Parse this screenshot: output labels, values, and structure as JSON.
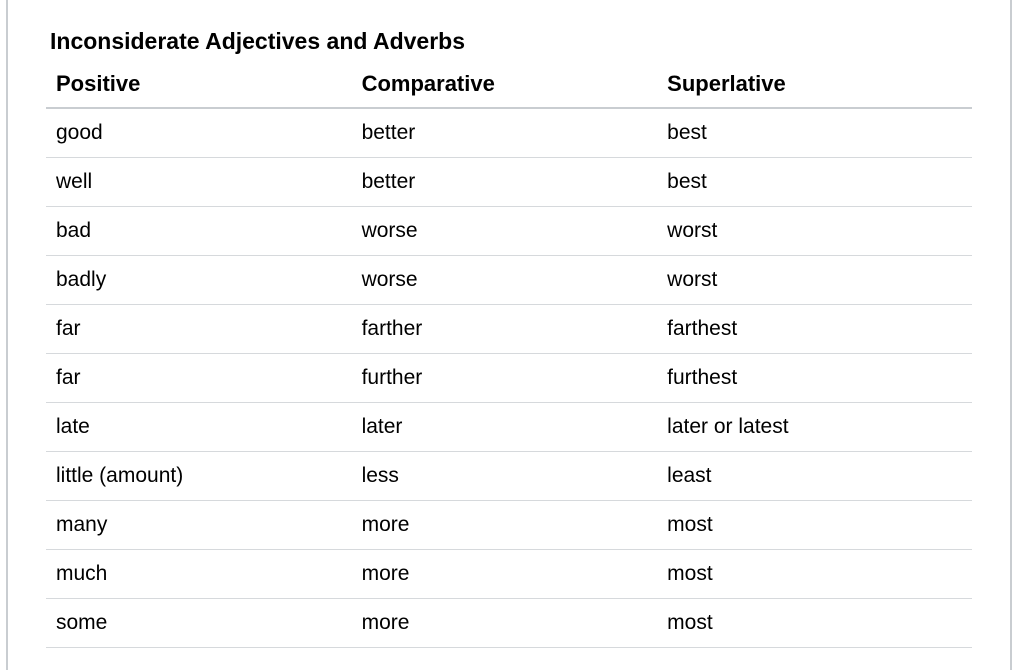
{
  "title": "Inconsiderate Adjectives and Adverbs",
  "headers": {
    "positive": "Positive",
    "comparative": "Comparative",
    "superlative": "Superlative"
  },
  "rows": [
    {
      "positive": "good",
      "comparative": "better",
      "superlative": "best"
    },
    {
      "positive": "well",
      "comparative": "better",
      "superlative": "best"
    },
    {
      "positive": "bad",
      "comparative": "worse",
      "superlative": "worst"
    },
    {
      "positive": "badly",
      "comparative": "worse",
      "superlative": "worst"
    },
    {
      "positive": "far",
      "comparative": "farther",
      "superlative": "farthest"
    },
    {
      "positive": "far",
      "comparative": "further",
      "superlative": "furthest"
    },
    {
      "positive": "late",
      "comparative": "later",
      "superlative": "later or latest"
    },
    {
      "positive": "little (amount)",
      "comparative": "less",
      "superlative": "least"
    },
    {
      "positive": "many",
      "comparative": "more",
      "superlative": "most"
    },
    {
      "positive": "much",
      "comparative": "more",
      "superlative": "most"
    },
    {
      "positive": "some",
      "comparative": "more",
      "superlative": "most"
    }
  ],
  "chart_data": {
    "type": "table",
    "title": "Inconsiderate Adjectives and Adverbs",
    "columns": [
      "Positive",
      "Comparative",
      "Superlative"
    ],
    "rows": [
      [
        "good",
        "better",
        "best"
      ],
      [
        "well",
        "better",
        "best"
      ],
      [
        "bad",
        "worse",
        "worst"
      ],
      [
        "badly",
        "worse",
        "worst"
      ],
      [
        "far",
        "farther",
        "farthest"
      ],
      [
        "far",
        "further",
        "furthest"
      ],
      [
        "late",
        "later",
        "later or latest"
      ],
      [
        "little (amount)",
        "less",
        "least"
      ],
      [
        "many",
        "more",
        "most"
      ],
      [
        "much",
        "more",
        "most"
      ],
      [
        "some",
        "more",
        "most"
      ]
    ]
  }
}
